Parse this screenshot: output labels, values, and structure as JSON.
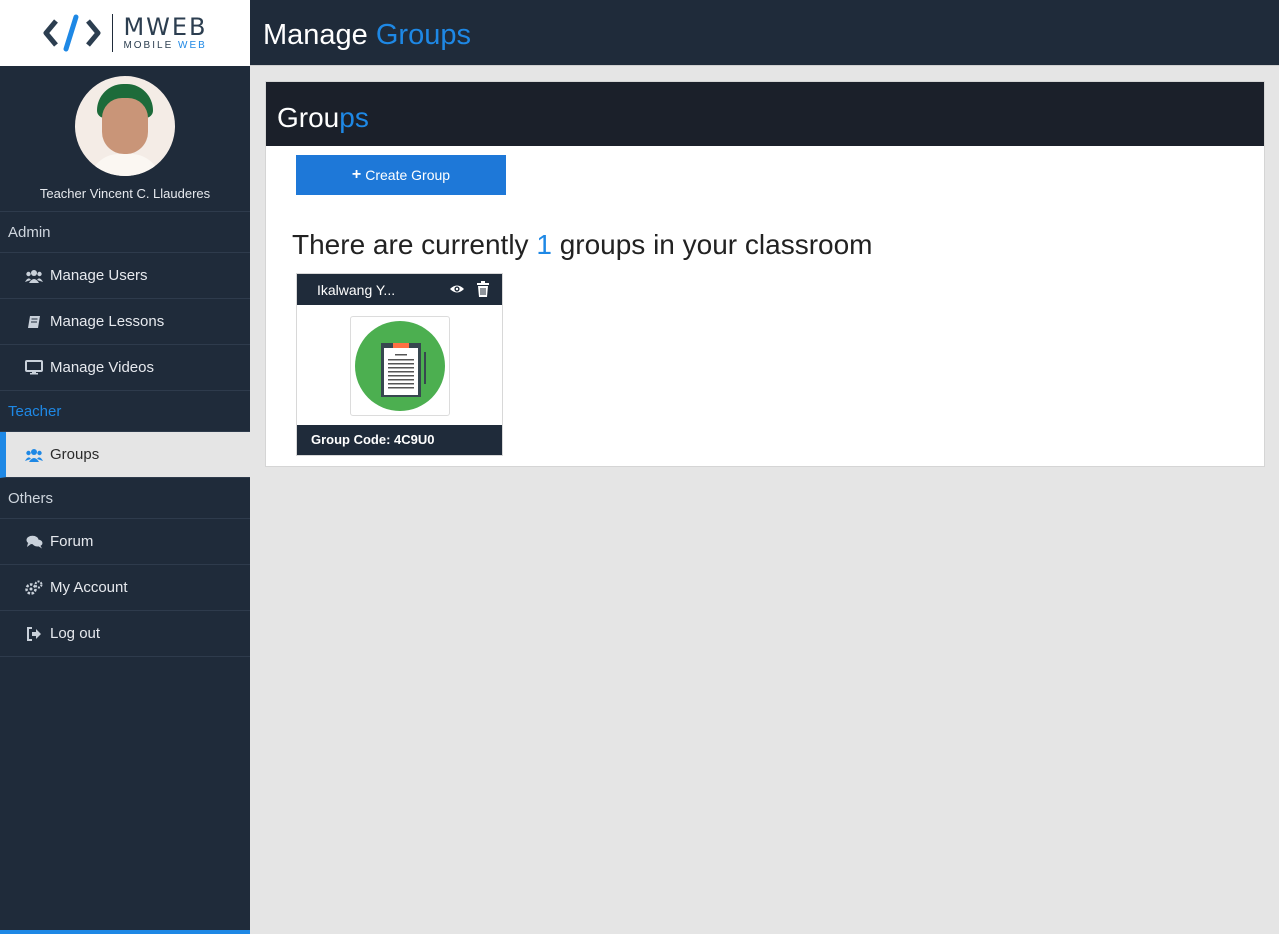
{
  "brand": {
    "title": "MWEB",
    "subtitle_prefix": "MOBILE",
    "subtitle_accent": "WEB",
    "accent_color": "#1e88e5",
    "dark_color": "#1f2b3a"
  },
  "header": {
    "title_main": "Manage",
    "title_accent": "Groups"
  },
  "profile": {
    "name": "Teacher Vincent C. Llauderes"
  },
  "sidebar": {
    "sections": [
      {
        "label": "Admin",
        "items": [
          {
            "label": "Manage Users",
            "icon": "users-icon"
          },
          {
            "label": "Manage Lessons",
            "icon": "book-icon"
          },
          {
            "label": "Manage Videos",
            "icon": "monitor-icon"
          }
        ]
      },
      {
        "label": "Teacher",
        "items": [
          {
            "label": "Groups",
            "icon": "users-icon",
            "active": true
          }
        ]
      },
      {
        "label": "Others",
        "items": [
          {
            "label": "Forum",
            "icon": "comments-icon"
          },
          {
            "label": "My Account",
            "icon": "gears-icon"
          },
          {
            "label": "Log out",
            "icon": "sign-out-icon"
          }
        ]
      }
    ]
  },
  "panel": {
    "title_main": "Grou",
    "title_accent": "ps",
    "create_button_label": "Create Group",
    "count_prefix": "There are currently",
    "count_value": "1",
    "count_suffix": "groups in your classroom"
  },
  "groups": [
    {
      "name": "Ikalwang Y...",
      "code_label": "Group Code: 4C9U0",
      "thumbnail_icon": "clipboard-icon",
      "thumbnail_color": "#4caf50"
    }
  ]
}
